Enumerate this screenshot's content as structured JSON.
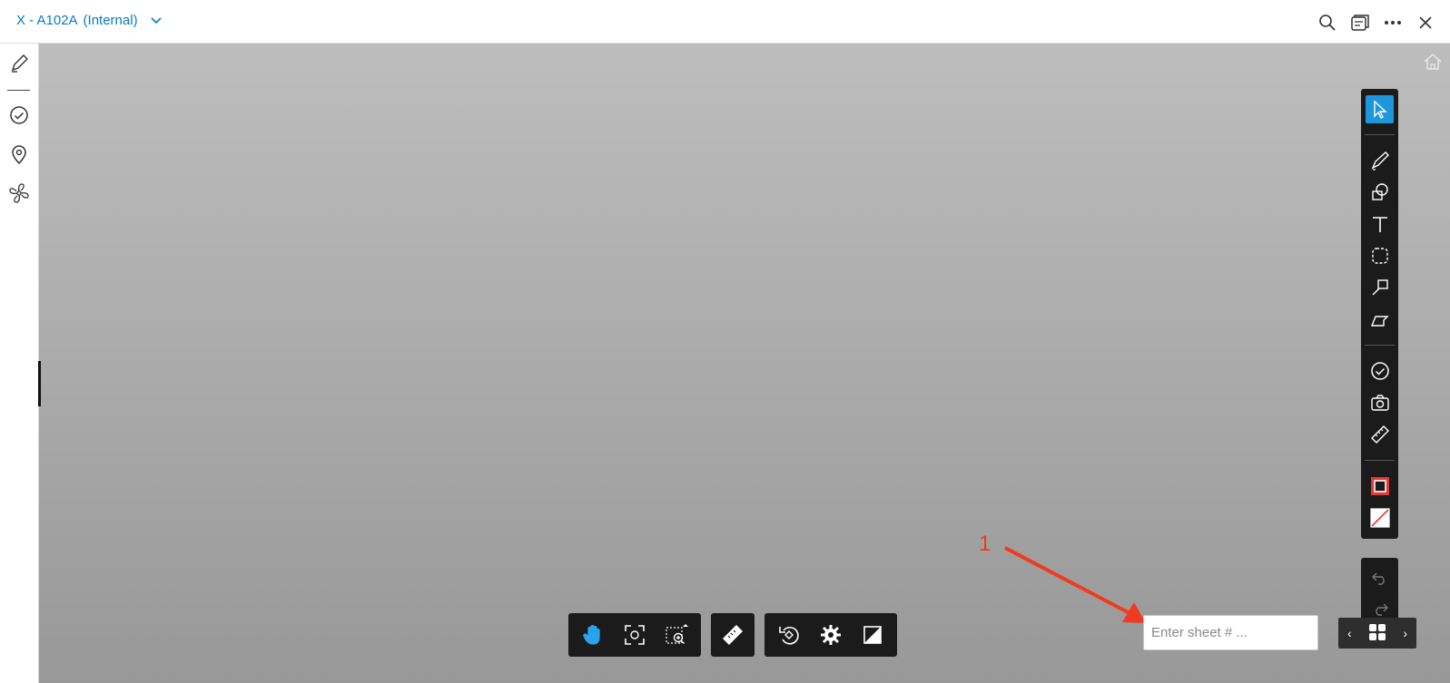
{
  "header": {
    "title": "X - A102A",
    "subtitle": "(Internal)",
    "icons": [
      "search-icon",
      "layout-icon",
      "more-icon",
      "close-icon"
    ]
  },
  "left_sidebar": {
    "items": [
      "markup-icon",
      "checklist-icon",
      "location-icon",
      "fan-icon"
    ]
  },
  "right_toolbar": {
    "active_tool": "select",
    "tools": [
      "select-icon",
      "pen-icon",
      "shapes-icon",
      "text-icon",
      "lasso-icon",
      "callout-icon",
      "polygon-icon",
      "issue-icon",
      "camera-icon",
      "measure-icon",
      "stroke-color-icon",
      "fill-color-icon"
    ],
    "accent_color": "#1e96dc",
    "stroke_color": "#e53935"
  },
  "history": {
    "items": [
      "undo-icon",
      "redo-icon"
    ]
  },
  "bottom_toolbar": {
    "group1": [
      "pan-icon",
      "fit-view-icon",
      "zoom-region-icon"
    ],
    "group2": [
      "ruler-icon"
    ],
    "group3": [
      "rotate-icon",
      "settings-icon",
      "compare-icon"
    ]
  },
  "sheet_input": {
    "placeholder": "Enter sheet # ..."
  },
  "pager": {
    "prev": "‹",
    "next": "›"
  },
  "annotation": {
    "label": "1",
    "color": "#f03a21"
  }
}
